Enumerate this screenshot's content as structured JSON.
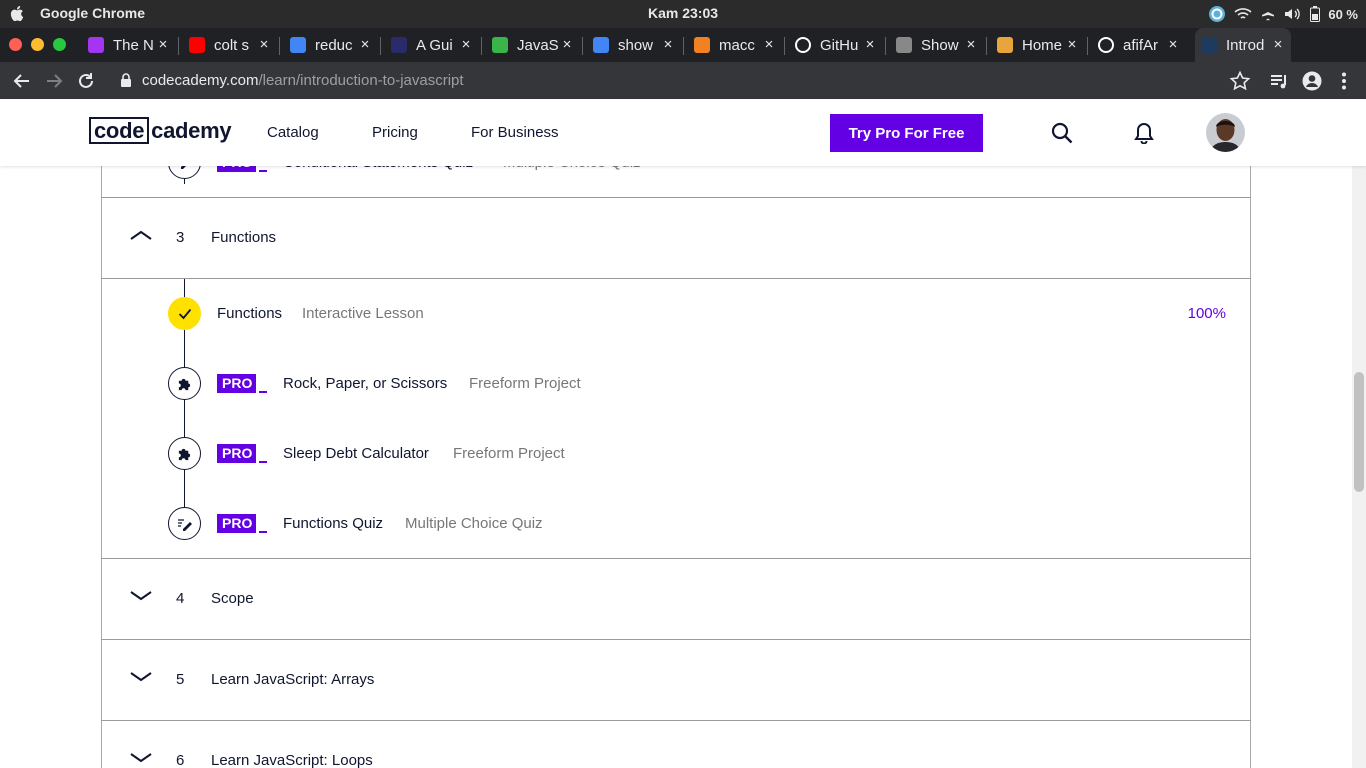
{
  "os_menubar": {
    "app_name": "Google Chrome",
    "clock": "Kam 23:03",
    "battery": "60 %"
  },
  "browser": {
    "tabs": [
      {
        "title": "The N",
        "icon": "udemy-icon",
        "color": "#a435f0"
      },
      {
        "title": "colt s",
        "icon": "youtube-icon",
        "color": "#ff0000"
      },
      {
        "title": "reduc",
        "icon": "google-icon",
        "color": "#4285f4"
      },
      {
        "title": "A Gui",
        "icon": "code-site-icon",
        "color": "#2b2b6b"
      },
      {
        "title": "JavaS",
        "icon": "chart-site-icon",
        "color": "#3ab54a"
      },
      {
        "title": "show",
        "icon": "google-icon",
        "color": "#4285f4"
      },
      {
        "title": "macc",
        "icon": "stackoverflow-icon",
        "color": "#f48024"
      },
      {
        "title": "GitHu",
        "icon": "github-icon",
        "color": "#ffffff"
      },
      {
        "title": "Show",
        "icon": "pixel-site-icon",
        "color": "#888888"
      },
      {
        "title": "Home",
        "icon": "fox-site-icon",
        "color": "#e8a53b"
      },
      {
        "title": "afifAr",
        "icon": "github-icon",
        "color": "#ffffff"
      },
      {
        "title": "Introd",
        "icon": "codecademy-icon",
        "color": "#1f3a5f"
      }
    ],
    "url_host": "codecademy.com",
    "url_path": "/learn/introduction-to-javascript"
  },
  "header": {
    "logo_box": "code",
    "logo_rest": "cademy",
    "nav": [
      "Catalog",
      "Pricing",
      "For Business"
    ],
    "cta": "Try Pro For Free"
  },
  "prev_item": {
    "name": "Conditional Statements Quiz",
    "type": "Multiple Choice Quiz",
    "badge": "PRO"
  },
  "chapters": [
    {
      "num": "3",
      "title": "Functions",
      "expanded": true
    },
    {
      "num": "4",
      "title": "Scope",
      "expanded": false
    },
    {
      "num": "5",
      "title": "Learn JavaScript: Arrays",
      "expanded": false
    },
    {
      "num": "6",
      "title": "Learn JavaScript: Loops",
      "expanded": false
    }
  ],
  "lessons": [
    {
      "name": "Functions",
      "type": "Interactive Lesson",
      "progress": "100%",
      "completed": true,
      "icon": "checkmark-icon"
    },
    {
      "name": "Rock, Paper, or Scissors",
      "type": "Freeform Project",
      "badge": "PRO",
      "icon": "puzzle-icon"
    },
    {
      "name": "Sleep Debt Calculator",
      "type": "Freeform Project",
      "badge": "PRO",
      "icon": "puzzle-icon"
    },
    {
      "name": "Functions Quiz",
      "type": "Multiple Choice Quiz",
      "badge": "PRO",
      "icon": "quiz-pencil-icon"
    }
  ],
  "colors": {
    "accent": "#6400e4",
    "complete": "#ffe100",
    "text": "#10162f"
  }
}
